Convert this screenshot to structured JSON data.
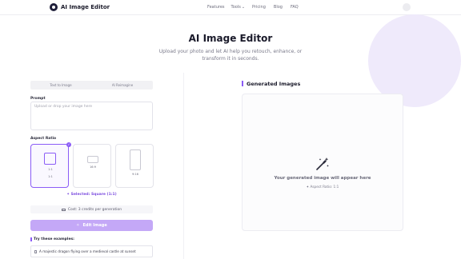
{
  "header": {
    "brand": "AI Image Editor",
    "nav": [
      "Features",
      "Tools",
      "Pricing",
      "Blog",
      "FAQ"
    ]
  },
  "hero": {
    "title": "AI Image Editor",
    "subtitle": "Upload your photo and let AI help you retouch, enhance, or transform it in seconds."
  },
  "tabs": [
    "Text to Image",
    "AI Reimagine"
  ],
  "prompt": {
    "label": "Prompt",
    "placeholder": "Upload or drop your image here"
  },
  "aspect_ratio": {
    "label": "Aspect Ratio",
    "options": [
      {
        "inner": "1:1",
        "caption": "1:1"
      },
      {
        "inner": "16:9"
      },
      {
        "inner": "9:16"
      }
    ],
    "selected_text": "✦ Selected: Square (1:1)"
  },
  "cost_text": "Cost: 3 credits per generation",
  "edit_button": "Edit Image",
  "examples": {
    "title": "Try these examples:",
    "items": [
      "A majestic dragon flying over a medieval castle at sunset"
    ]
  },
  "generated": {
    "title": "Generated Images",
    "placeholder": "Your generated image will appear here",
    "aspect_hint": "✦ Aspect Ratio: 1:1"
  },
  "colors": {
    "accent": "#8b5cf6",
    "button": "#c4a8f7",
    "decor": "#efeafb"
  }
}
